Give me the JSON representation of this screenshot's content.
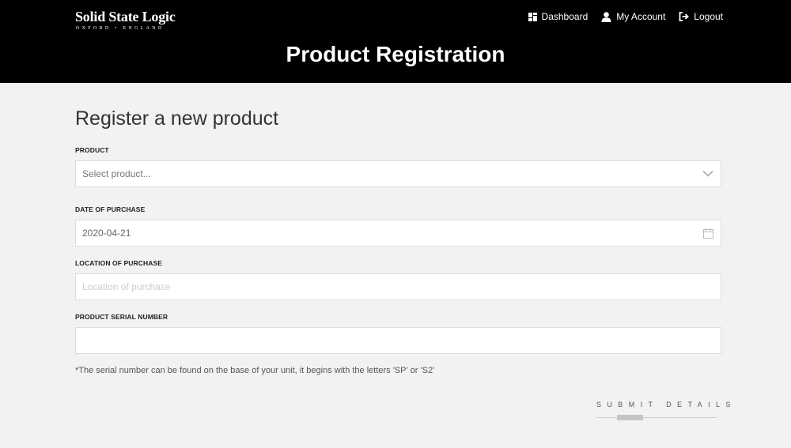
{
  "header": {
    "logo_main": "Solid State Logic",
    "logo_sub": "OXFORD • ENGLAND",
    "nav": [
      {
        "label": "Dashboard",
        "icon": "dashboard-icon"
      },
      {
        "label": "My Account",
        "icon": "user-icon"
      },
      {
        "label": "Logout",
        "icon": "logout-icon"
      }
    ],
    "title": "Product Registration"
  },
  "form": {
    "heading": "Register a new product",
    "product": {
      "label": "PRODUCT",
      "value": "Select product..."
    },
    "date": {
      "label": "DATE OF PURCHASE",
      "value": "2020-04-21"
    },
    "location": {
      "label": "LOCATION OF PURCHASE",
      "placeholder": "Location of purchase",
      "value": ""
    },
    "serial": {
      "label": "PRODUCT SERIAL NUMBER",
      "placeholder": "",
      "value": ""
    },
    "hint": "*The serial number can be found on the base of your unit, it begins with the letters 'SP' or 'S2'",
    "submit_label": "SUBMIT DETAILS"
  },
  "colors": {
    "header_bg": "#000000",
    "page_bg": "#f2f2f2"
  }
}
